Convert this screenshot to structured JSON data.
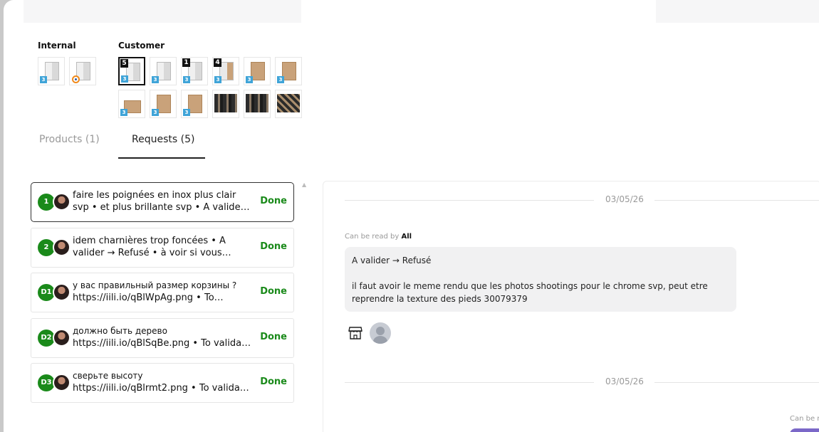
{
  "gallery": {
    "internal_label": "Internal",
    "customer_label": "Customer",
    "internal": [
      {
        "kind": "cabinet-white",
        "badge": "3"
      },
      {
        "kind": "cabinet-white",
        "badge": "blender"
      }
    ],
    "customer": [
      {
        "kind": "cabinet-white",
        "badge": "3",
        "count": "5",
        "selected": true
      },
      {
        "kind": "cabinet-white",
        "badge": "3"
      },
      {
        "kind": "cabinet-white",
        "badge": "3",
        "count": "1"
      },
      {
        "kind": "cabinet-mixed",
        "badge": "3",
        "count": "4"
      },
      {
        "kind": "cabinet-wood",
        "badge": "3"
      },
      {
        "kind": "cabinet-wood",
        "badge": "3"
      },
      {
        "kind": "cabinet-wood-low",
        "badge": "3"
      },
      {
        "kind": "cabinet-wood",
        "badge": "3"
      },
      {
        "kind": "cabinet-wood",
        "badge": "3"
      },
      {
        "kind": "photo"
      },
      {
        "kind": "photo"
      },
      {
        "kind": "photo-b"
      }
    ]
  },
  "tabs": {
    "products": "Products (1)",
    "requests": "Requests (5)"
  },
  "requests": [
    {
      "num": "1",
      "line1": "faire les poignées en inox plus clair",
      "line2": "svp • et plus brillante svp • A valider …",
      "status": "Done",
      "active": true
    },
    {
      "num": "2",
      "line1": "idem charnières trop foncées • A",
      "line2": "valider → Refusé • à voir si vous…",
      "status": "Done"
    },
    {
      "num": "D1",
      "line1": "у вас правильный размер корзины ?",
      "line2": "https://iili.io/qBlWpAg.png • To…",
      "status": "Done",
      "small": true
    },
    {
      "num": "D2",
      "line1": "должно быть дерево",
      "line2": "https://iili.io/qBlSqBe.png • To validat…",
      "status": "Done",
      "small": true
    },
    {
      "num": "D3",
      "line1": "сверьте высоту",
      "line2": "https://iili.io/qBlrmt2.png • To validat…",
      "status": "Done",
      "small": true
    }
  ],
  "chat": {
    "date1": "03/05/26",
    "readby_prefix": "Can be read by",
    "readby_value": "All",
    "message_line1": "A valider → Refusé",
    "message_line2": "il faut avoir le meme rendu que les photos shootings pour le chrome svp, peut etre reprendre la texture des pieds 30079379",
    "date2": "03/05/26",
    "readby_cut": "Can be r"
  }
}
